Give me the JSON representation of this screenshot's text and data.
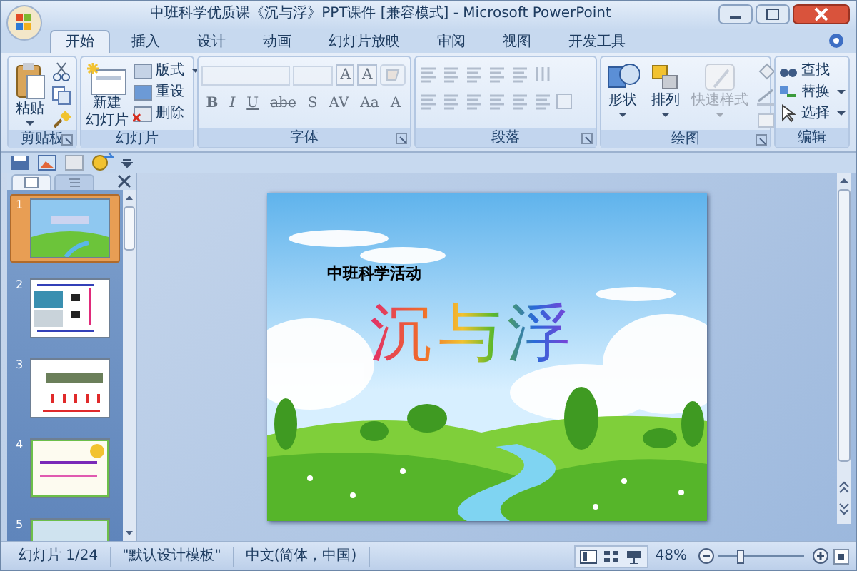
{
  "window": {
    "title": "中班科学优质课《沉与浮》PPT课件 [兼容模式] - Microsoft PowerPoint"
  },
  "tabs": [
    {
      "label": "开始",
      "selected": true
    },
    {
      "label": "插入",
      "selected": false
    },
    {
      "label": "设计",
      "selected": false
    },
    {
      "label": "动画",
      "selected": false
    },
    {
      "label": "幻灯片放映",
      "selected": false
    },
    {
      "label": "审阅",
      "selected": false
    },
    {
      "label": "视图",
      "selected": false
    },
    {
      "label": "开发工具",
      "selected": false
    }
  ],
  "ribbon": {
    "groups": [
      {
        "kind": "clipboard",
        "label": "剪贴板",
        "launcher": true,
        "paste": "粘贴"
      },
      {
        "kind": "slides",
        "label": "幻灯片",
        "launcher": false,
        "new_slide": [
          "新建",
          "幻灯片"
        ],
        "commands": [
          "版式",
          "重设",
          "删除"
        ]
      },
      {
        "kind": "font",
        "label": "字体",
        "launcher": true,
        "disabled": true,
        "size_buttons": [
          "A",
          "A"
        ],
        "buttons": [
          "B",
          "I",
          "U",
          "abe",
          "S",
          "AV",
          "Aa",
          "A"
        ]
      },
      {
        "kind": "paragraph",
        "label": "段落",
        "launcher": true,
        "disabled": true
      },
      {
        "kind": "drawing",
        "label": "绘图",
        "launcher": true,
        "large": [
          {
            "label": "形状",
            "disabled": false
          },
          {
            "label": "排列",
            "disabled": false
          },
          {
            "label": "快速样式",
            "disabled": true
          }
        ]
      },
      {
        "kind": "editing",
        "label": "编辑",
        "launcher": false,
        "commands": [
          {
            "label": "查找",
            "dropdown": false
          },
          {
            "label": "替换",
            "dropdown": true
          },
          {
            "label": "选择",
            "dropdown": true
          }
        ]
      }
    ]
  },
  "pane": {
    "tabs": [
      {
        "kind": "slides",
        "selected": true
      },
      {
        "kind": "outline",
        "selected": false
      }
    ],
    "thumbnails": [
      {
        "number": "1",
        "kind": "landscape",
        "selected": true
      },
      {
        "number": "2",
        "kind": "diagram",
        "selected": false
      },
      {
        "number": "3",
        "kind": "table",
        "selected": false
      },
      {
        "number": "4",
        "kind": "notice",
        "selected": false
      },
      {
        "number": "5",
        "kind": "photo",
        "selected": false
      }
    ]
  },
  "slide": {
    "subtitle": "中班科学活动",
    "title": "沉与浮"
  },
  "status_bar": {
    "items": [
      "幻灯片 1/24",
      "\"默认设计模板\"",
      "中文(简体，中国)"
    ],
    "zoom": "48%",
    "zoom_slider": {
      "level": 0.25
    }
  }
}
